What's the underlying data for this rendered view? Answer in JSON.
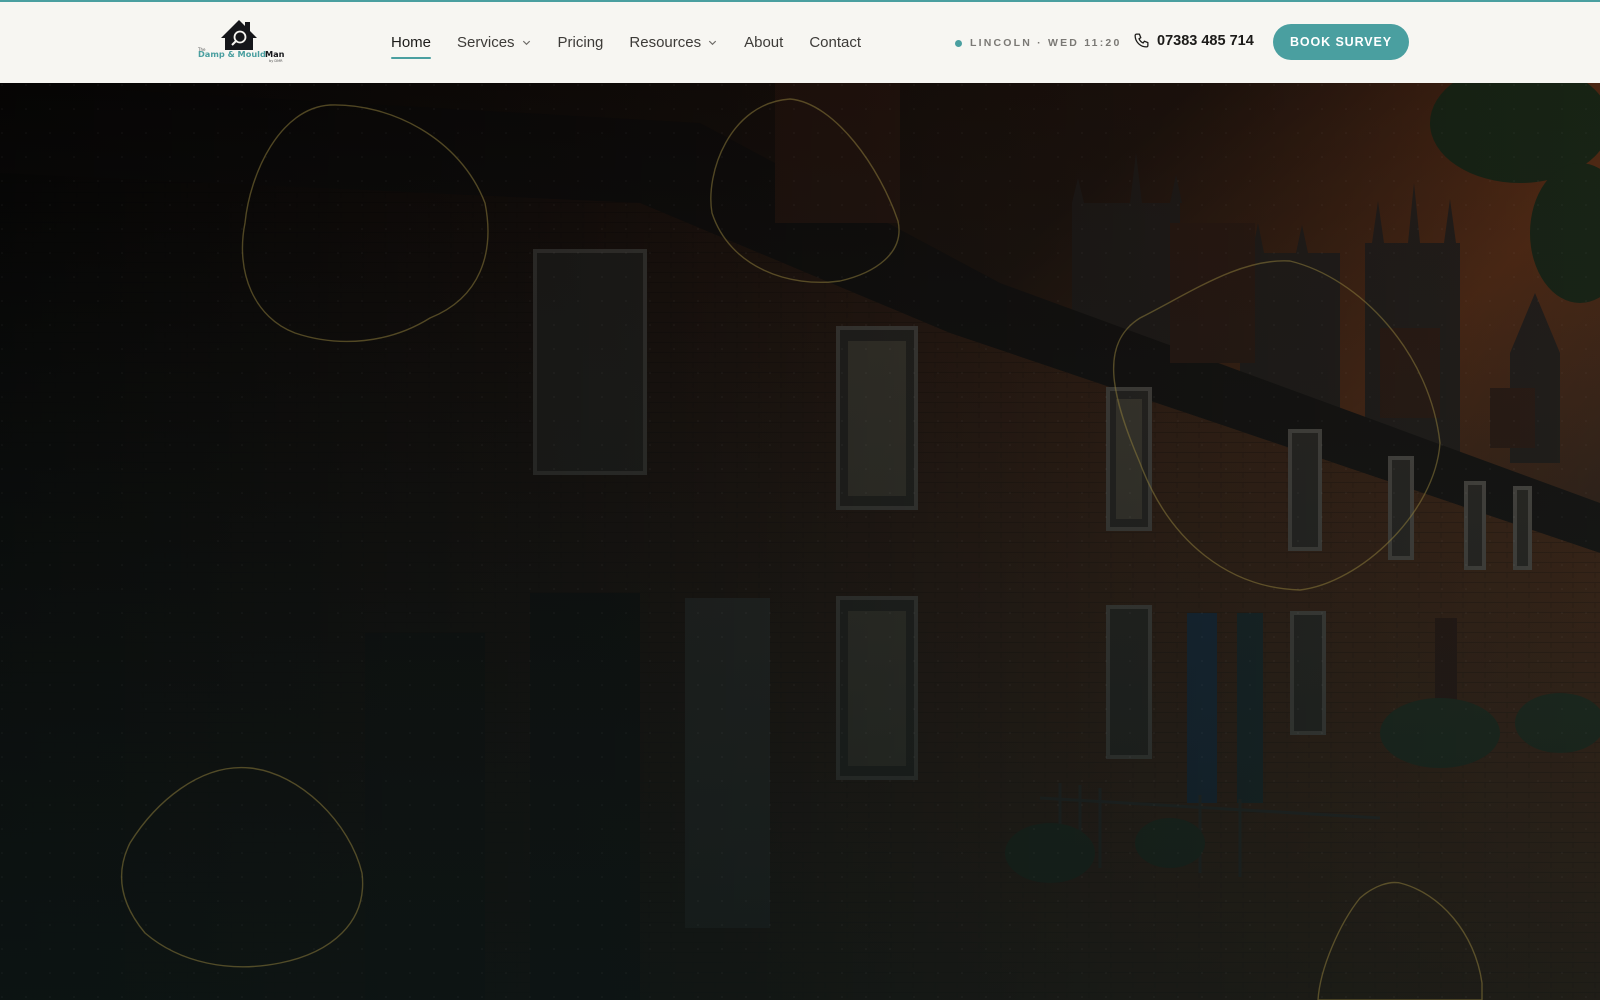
{
  "brand": {
    "logo_text_prefix": "The",
    "logo_text_main": "Damp & Mould",
    "logo_text_accent": "Man",
    "logo_text_suffix": "by DMR",
    "accent_color": "#4a9fa0"
  },
  "nav": {
    "items": [
      {
        "label": "Home",
        "active": true,
        "has_dropdown": false
      },
      {
        "label": "Services",
        "active": false,
        "has_dropdown": true
      },
      {
        "label": "Pricing",
        "active": false,
        "has_dropdown": false
      },
      {
        "label": "Resources",
        "active": false,
        "has_dropdown": true
      },
      {
        "label": "About",
        "active": false,
        "has_dropdown": false
      },
      {
        "label": "Contact",
        "active": false,
        "has_dropdown": false
      }
    ]
  },
  "status": {
    "text": "LINCOLN · WED 11:20"
  },
  "contact": {
    "phone": "07383 485 714",
    "icon": "phone-icon"
  },
  "cta": {
    "label": "BOOK SURVEY"
  },
  "hero": {
    "image": "terraced-brick-houses-lincoln-cathedral-dusk"
  }
}
